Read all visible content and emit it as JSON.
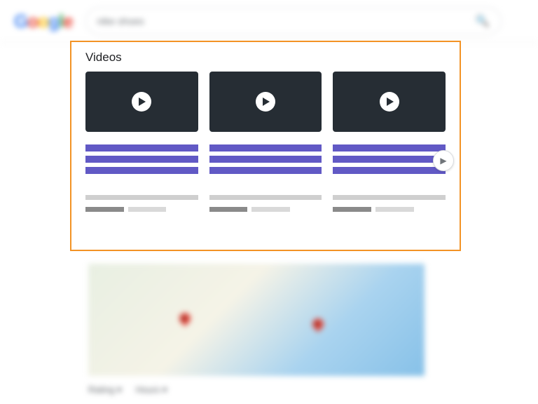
{
  "header": {
    "logo_letters": [
      "G",
      "o",
      "o",
      "g",
      "l",
      "e"
    ],
    "search_query": "nike shoes"
  },
  "videos": {
    "title": "Videos",
    "card_count": 3
  },
  "filters": {
    "rating_label": "Rating ▾",
    "hours_label": "Hours ▾"
  }
}
